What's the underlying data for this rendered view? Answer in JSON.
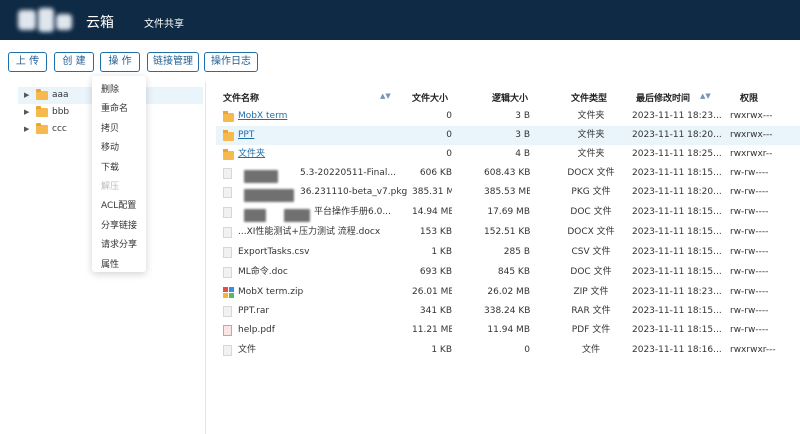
{
  "header": {
    "app_title": "云箱",
    "nav_link": "文件共享"
  },
  "toolbar": {
    "upload": "上 传",
    "create": "创 建",
    "operate": "操 作",
    "link_manage": "链接管理",
    "op_log": "操作日志"
  },
  "tree": {
    "items": [
      {
        "label": "aaa",
        "selected": true
      },
      {
        "label": "bbb",
        "selected": false
      },
      {
        "label": "ccc",
        "selected": false
      }
    ]
  },
  "context_menu": {
    "items": [
      {
        "label": "删除",
        "disabled": false
      },
      {
        "label": "重命名",
        "disabled": false
      },
      {
        "label": "拷贝",
        "disabled": false
      },
      {
        "label": "移动",
        "disabled": false
      },
      {
        "label": "下载",
        "disabled": false
      },
      {
        "label": "解压",
        "disabled": true
      },
      {
        "label": "ACL配置",
        "disabled": false
      },
      {
        "label": "分享链接",
        "disabled": false
      },
      {
        "label": "请求分享",
        "disabled": false
      },
      {
        "label": "属性",
        "disabled": false
      }
    ]
  },
  "table": {
    "headers": {
      "name": "文件名称",
      "size": "文件大小",
      "logical_size": "逻辑大小",
      "type": "文件类型",
      "modified": "最后修改时间",
      "perm": "权限"
    },
    "rows": [
      {
        "name": "MobX term",
        "size": "0",
        "logical_size": "3 B",
        "type": "文件夹",
        "modified": "2023-11-11 18:23...",
        "perm": "rwxrwx---",
        "icon": "folder",
        "link": true
      },
      {
        "name": "PPT",
        "size": "0",
        "logical_size": "3 B",
        "type": "文件夹",
        "modified": "2023-11-11 18:20...",
        "perm": "rwxrwx---",
        "icon": "folder",
        "link": true,
        "selected": true
      },
      {
        "name": "文件夹",
        "size": "0",
        "logical_size": "4 B",
        "type": "文件夹",
        "modified": "2023-11-11 18:25...",
        "perm": "rwxrwxr--",
        "icon": "folder",
        "link": true
      },
      {
        "name": "5.3-20220511-Final...",
        "size": "606 KB",
        "logical_size": "608.43 KB",
        "type": "DOCX 文件",
        "modified": "2023-11-11 18:15...",
        "perm": "rw-rw----",
        "icon": "file",
        "redacted": true
      },
      {
        "name": "36.231110-beta_v7.pkg",
        "size": "385.31 MB",
        "logical_size": "385.53 MB",
        "type": "PKG 文件",
        "modified": "2023-11-11 18:20...",
        "perm": "rw-rw----",
        "icon": "file",
        "redacted": true
      },
      {
        "name": "平台操作手册6.0...",
        "size": "14.94 MB",
        "logical_size": "17.69 MB",
        "type": "DOC 文件",
        "modified": "2023-11-11 18:15...",
        "perm": "rw-rw----",
        "icon": "file",
        "redacted": true
      },
      {
        "name": "...XI性能测试+压力测试 流程.docx",
        "size": "153 KB",
        "logical_size": "152.51 KB",
        "type": "DOCX 文件",
        "modified": "2023-11-11 18:15...",
        "perm": "rw-rw----",
        "icon": "file"
      },
      {
        "name": "ExportTasks.csv",
        "size": "1 KB",
        "logical_size": "285 B",
        "type": "CSV 文件",
        "modified": "2023-11-11 18:15...",
        "perm": "rw-rw----",
        "icon": "file"
      },
      {
        "name": "ML命令.doc",
        "size": "693 KB",
        "logical_size": "845 KB",
        "type": "DOC 文件",
        "modified": "2023-11-11 18:15...",
        "perm": "rw-rw----",
        "icon": "file"
      },
      {
        "name": "MobX term.zip",
        "size": "26.01 MB",
        "logical_size": "26.02 MB",
        "type": "ZIP 文件",
        "modified": "2023-11-11 18:23...",
        "perm": "rw-rw----",
        "icon": "zip"
      },
      {
        "name": "PPT.rar",
        "size": "341 KB",
        "logical_size": "338.24 KB",
        "type": "RAR 文件",
        "modified": "2023-11-11 18:15...",
        "perm": "rw-rw----",
        "icon": "file"
      },
      {
        "name": "help.pdf",
        "size": "11.21 MB",
        "logical_size": "11.94 MB",
        "type": "PDF 文件",
        "modified": "2023-11-11 18:15...",
        "perm": "rw-rw----",
        "icon": "pdf"
      },
      {
        "name": "文件",
        "size": "1 KB",
        "logical_size": "0",
        "type": "文件",
        "modified": "2023-11-11 18:16...",
        "perm": "rwxrwxr---",
        "icon": "file"
      }
    ]
  },
  "colors": {
    "header_bg": "#0f2a44",
    "accent": "#1f6fa8",
    "selected_row": "#eaf4fb",
    "folder": "#f6b94d"
  }
}
